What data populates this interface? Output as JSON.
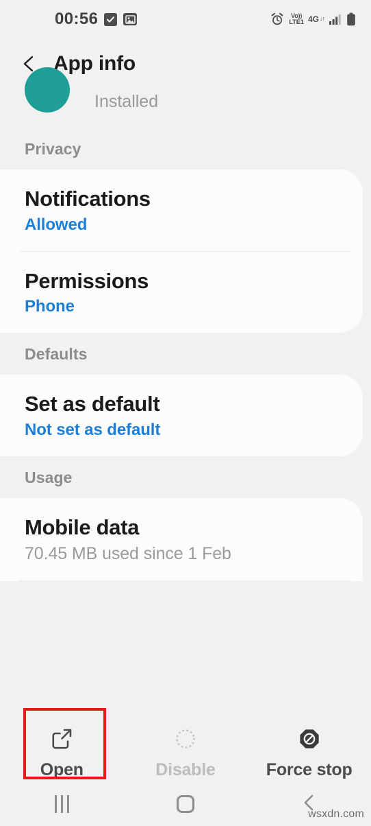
{
  "status_bar": {
    "clock": "00:56",
    "left_icons": [
      "checkbox-checked-icon",
      "gallery-image-icon"
    ],
    "right_icons": [
      "alarm-icon",
      "volte-icon",
      "network-4g-icon",
      "signal-bars-icon",
      "battery-icon"
    ],
    "volte_top": "Vo))",
    "volte_bottom": "LTE1",
    "network_type": "4G",
    "data_arrows": "↓↑"
  },
  "app_bar": {
    "back_icon": "chevron-left-icon",
    "title": "App info"
  },
  "app_header": {
    "status": "Installed",
    "icon_color": "#1f9e98"
  },
  "sections": [
    {
      "label": "Privacy",
      "rows": [
        {
          "title": "Notifications",
          "subtitle": "Allowed",
          "subtitle_style": "blue"
        },
        {
          "title": "Permissions",
          "subtitle": "Phone",
          "subtitle_style": "blue"
        }
      ]
    },
    {
      "label": "Defaults",
      "rows": [
        {
          "title": "Set as default",
          "subtitle": "Not set as default",
          "subtitle_style": "blue"
        }
      ]
    },
    {
      "label": "Usage",
      "rows": [
        {
          "title": "Mobile data",
          "subtitle": "70.45 MB used since 1 Feb",
          "subtitle_style": "grey"
        }
      ]
    }
  ],
  "action_bar": {
    "actions": [
      {
        "label": "Open",
        "icon": "external-link-icon",
        "disabled": false,
        "highlighted": true
      },
      {
        "label": "Disable",
        "icon": "dotted-circle-icon",
        "disabled": true,
        "highlighted": false
      },
      {
        "label": "Force stop",
        "icon": "prohibited-octagon-icon",
        "disabled": false,
        "highlighted": false
      }
    ]
  },
  "nav_bar": {
    "recents_icon": "recents-icon",
    "home_icon": "home-square-icon",
    "back_icon": "back-chevron-icon"
  },
  "watermark": "wsxdn.com",
  "colors": {
    "accent_blue": "#1b7fd8",
    "highlight_red": "#e81b1b",
    "background": "#f1f1f1",
    "card": "#fcfcfc",
    "muted": "#9a9a9a"
  }
}
